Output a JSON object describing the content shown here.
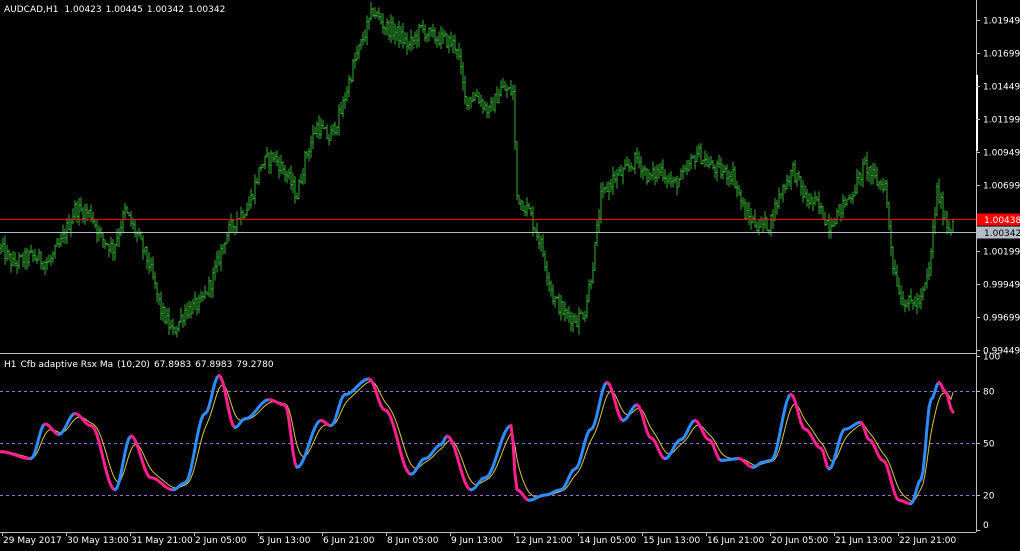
{
  "chart_data": [
    {
      "type": "ohlc",
      "symbol": "AUDCAD",
      "timeframe": "H1",
      "last_bar": {
        "open": "1.00423",
        "high": "1.00445",
        "low": "1.00342",
        "close": "1.00342"
      },
      "bar_color": "#33aa33",
      "ylim": [
        0.99449,
        1.01949
      ],
      "y_ticks": [
        "1.01949",
        "1.01699",
        "1.01449",
        "1.01199",
        "1.00949",
        "1.00699",
        "1.00199",
        "0.99949",
        "0.99699",
        "0.99449"
      ],
      "horizontal_lines": [
        {
          "value": "1.00438",
          "color": "#ff0000",
          "text_color": "#ffffff"
        },
        {
          "value": "1.00342",
          "color": "#b4bcc8",
          "text_color": "#000000"
        }
      ],
      "x_tick_labels": [
        "29 May 2017",
        "30 May 13:00",
        "31 May 21:00",
        "2 Jun 05:00",
        "5 Jun 13:00",
        "6 Jun 21:00",
        "8 Jun 05:00",
        "9 Jun 13:00",
        "12 Jun 21:00",
        "14 Jun 05:00",
        "15 Jun 13:00",
        "16 Jun 21:00",
        "20 Jun 05:00",
        "21 Jun 13:00",
        "22 Jun 21:00"
      ],
      "close_anchors": [
        [
          0,
          1.0022
        ],
        [
          6,
          1.001
        ],
        [
          15,
          1.0016
        ],
        [
          24,
          1.0011
        ],
        [
          30,
          1.0026
        ],
        [
          37,
          1.0052
        ],
        [
          45,
          1.0048
        ],
        [
          50,
          1.003
        ],
        [
          56,
          1.0022
        ],
        [
          62,
          1.005
        ],
        [
          68,
          1.0032
        ],
        [
          74,
          1.001
        ],
        [
          80,
          0.9975
        ],
        [
          86,
          0.9958
        ],
        [
          92,
          0.9975
        ],
        [
          100,
          0.998
        ],
        [
          106,
          1.0
        ],
        [
          112,
          1.003
        ],
        [
          118,
          1.0045
        ],
        [
          124,
          1.0055
        ],
        [
          130,
          1.0085
        ],
        [
          136,
          1.0092
        ],
        [
          142,
          1.008
        ],
        [
          148,
          1.0062
        ],
        [
          152,
          1.009
        ],
        [
          158,
          1.0115
        ],
        [
          164,
          1.0105
        ],
        [
          170,
          1.0125
        ],
        [
          176,
          1.016
        ],
        [
          182,
          1.0185
        ],
        [
          186,
          1.0202
        ],
        [
          192,
          1.019
        ],
        [
          198,
          1.0185
        ],
        [
          204,
          1.0175
        ],
        [
          210,
          1.0188
        ],
        [
          216,
          1.0182
        ],
        [
          222,
          1.018
        ],
        [
          228,
          1.0175
        ],
        [
          232,
          1.0135
        ],
        [
          238,
          1.0138
        ],
        [
          244,
          1.0125
        ],
        [
          250,
          1.0143
        ],
        [
          256,
          1.014
        ],
        [
          258,
          1.0062
        ],
        [
          264,
          1.005
        ],
        [
          270,
          1.0025
        ],
        [
          276,
          0.9985
        ],
        [
          282,
          0.9972
        ],
        [
          288,
          0.9968
        ],
        [
          292,
          0.9975
        ],
        [
          296,
          1.001
        ],
        [
          300,
          1.006
        ],
        [
          306,
          1.0075
        ],
        [
          312,
          1.008
        ],
        [
          318,
          1.009
        ],
        [
          324,
          1.0075
        ],
        [
          330,
          1.0082
        ],
        [
          336,
          1.007
        ],
        [
          342,
          1.0078
        ],
        [
          348,
          1.0095
        ],
        [
          354,
          1.0085
        ],
        [
          360,
          1.008
        ],
        [
          366,
          1.0078
        ],
        [
          372,
          1.0048
        ],
        [
          378,
          1.004
        ],
        [
          384,
          1.004
        ],
        [
          390,
          1.0065
        ],
        [
          396,
          1.0082
        ],
        [
          402,
          1.006
        ],
        [
          408,
          1.0055
        ],
        [
          414,
          1.004
        ],
        [
          420,
          1.0052
        ],
        [
          426,
          1.0065
        ],
        [
          432,
          1.0085
        ],
        [
          438,
          1.0072
        ],
        [
          442,
          1.007
        ],
        [
          446,
          1.001
        ],
        [
          450,
          0.9985
        ],
        [
          454,
          0.998
        ],
        [
          460,
          0.9982
        ],
        [
          464,
          1.0005
        ],
        [
          468,
          1.0065
        ],
        [
          473,
          1.004
        ],
        [
          476,
          1.00342
        ]
      ]
    },
    {
      "type": "line",
      "timeframe": "H1",
      "indicator": "Cfb adaptive Rsx Ma",
      "params": "(10,20)",
      "values": [
        "67.8983",
        "67.8983",
        "79.2780"
      ],
      "ylim": [
        0,
        100
      ],
      "y_ticks": [
        "100",
        "80",
        "50",
        "20",
        "0"
      ],
      "levels": [
        20,
        50,
        80
      ],
      "colors": {
        "up": "#2f8cff",
        "down": "#ff1f8f",
        "ma": "#d8c44a",
        "levels": "#9a6cd0"
      },
      "anchors": [
        [
          0,
          45
        ],
        [
          15,
          41
        ],
        [
          22,
          61
        ],
        [
          29,
          55
        ],
        [
          37,
          67
        ],
        [
          45,
          60
        ],
        [
          57,
          23
        ],
        [
          65,
          54
        ],
        [
          75,
          30
        ],
        [
          86,
          23
        ],
        [
          92,
          27
        ],
        [
          102,
          67
        ],
        [
          109,
          89
        ],
        [
          117,
          59
        ],
        [
          122,
          64
        ],
        [
          134,
          75
        ],
        [
          142,
          72
        ],
        [
          148,
          36
        ],
        [
          160,
          63
        ],
        [
          165,
          60
        ],
        [
          172,
          78
        ],
        [
          184,
          87
        ],
        [
          192,
          69
        ],
        [
          205,
          32
        ],
        [
          212,
          41
        ],
        [
          220,
          49
        ],
        [
          223,
          54
        ],
        [
          235,
          23
        ],
        [
          242,
          30
        ],
        [
          255,
          60
        ],
        [
          258,
          23
        ],
        [
          264,
          17
        ],
        [
          272,
          20
        ],
        [
          280,
          23
        ],
        [
          287,
          35
        ],
        [
          295,
          58
        ],
        [
          303,
          85
        ],
        [
          311,
          63
        ],
        [
          318,
          72
        ],
        [
          325,
          53
        ],
        [
          332,
          41
        ],
        [
          340,
          52
        ],
        [
          347,
          63
        ],
        [
          354,
          52
        ],
        [
          360,
          40
        ],
        [
          369,
          41
        ],
        [
          376,
          36
        ],
        [
          381,
          39
        ],
        [
          385,
          40
        ],
        [
          395,
          78
        ],
        [
          402,
          58
        ],
        [
          410,
          47
        ],
        [
          414,
          35
        ],
        [
          422,
          58
        ],
        [
          430,
          62
        ],
        [
          434,
          52
        ],
        [
          441,
          40
        ],
        [
          449,
          17
        ],
        [
          455,
          15
        ],
        [
          460,
          29
        ],
        [
          465,
          75
        ],
        [
          469,
          85
        ],
        [
          472,
          80
        ],
        [
          476,
          67.8983
        ]
      ]
    }
  ]
}
